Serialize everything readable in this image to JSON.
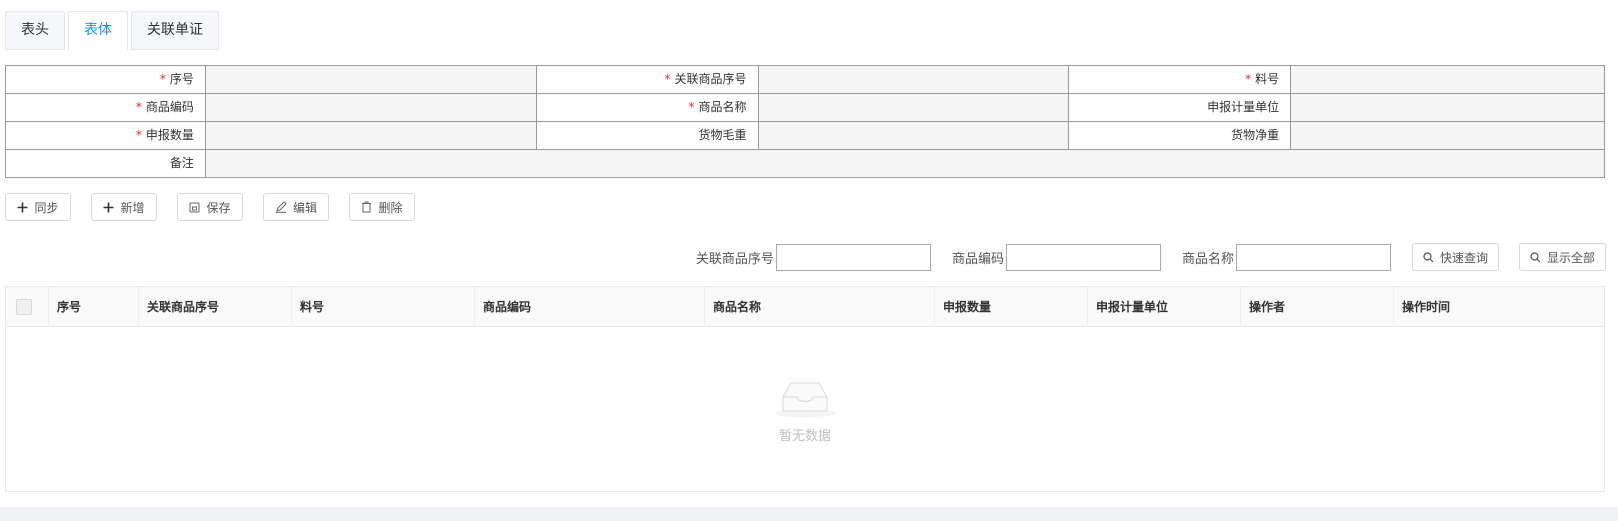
{
  "tabs": [
    {
      "label": "表头",
      "active": false
    },
    {
      "label": "表体",
      "active": true
    },
    {
      "label": "关联单证",
      "active": false
    }
  ],
  "form": {
    "row1": {
      "l1": "序号",
      "l2": "关联商品序号",
      "l3": "料号"
    },
    "row2": {
      "l1": "商品编码",
      "l2": "商品名称",
      "l3": "申报计量单位"
    },
    "row3": {
      "l1": "申报数量",
      "l2": "货物毛重",
      "l3": "货物净重"
    },
    "row4": {
      "l1": "备注"
    }
  },
  "toolbar": {
    "sync": "同步",
    "add": "新增",
    "save": "保存",
    "edit": "编辑",
    "delete": "删除"
  },
  "search": {
    "f1_label": "关联商品序号",
    "f2_label": "商品编码",
    "f3_label": "商品名称",
    "quick": "快速查询",
    "showall": "显示全部"
  },
  "table": {
    "columns": [
      "序号",
      "关联商品序号",
      "料号",
      "商品编码",
      "商品名称",
      "申报数量",
      "申报计量单位",
      "操作者",
      "操作时间"
    ],
    "empty_text": "暂无数据"
  },
  "colors": {
    "accent": "#1890ff",
    "required": "#f5222d"
  }
}
